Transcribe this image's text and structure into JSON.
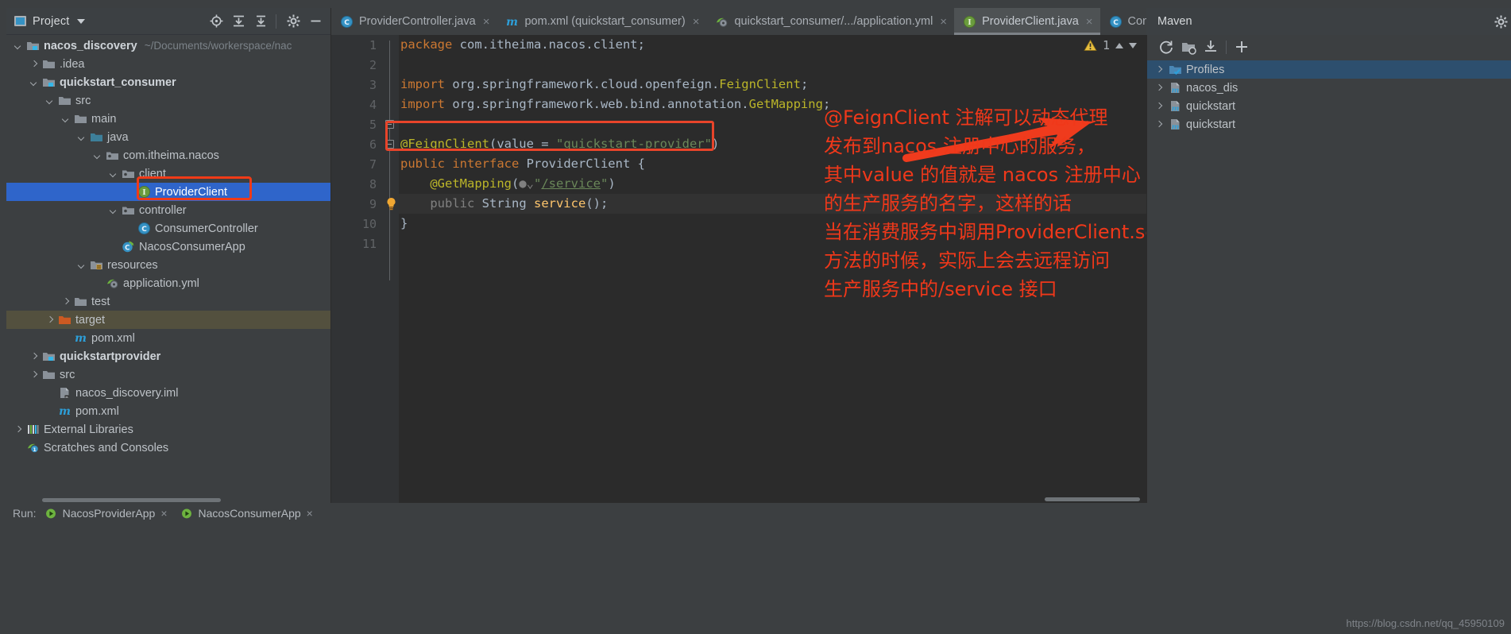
{
  "window": {
    "project_tool_title": "Project",
    "maven_tool_title": "Maven"
  },
  "project_panel": {
    "header_icons": [
      "locate-icon",
      "collapse-all-icon",
      "expand-collapse-icon",
      "settings-gear-icon",
      "hide-minus-icon"
    ],
    "tree": [
      {
        "indent": 0,
        "arrow": "down",
        "icon": "module-folder-icon",
        "label": "nacos_discovery",
        "bold": true,
        "sub": "~/Documents/workerspace/nac"
      },
      {
        "indent": 1,
        "arrow": "right",
        "icon": "folder-icon",
        "label": ".idea",
        "bold": false,
        "sub": ""
      },
      {
        "indent": 1,
        "arrow": "down",
        "icon": "module-folder-icon",
        "label": "quickstart_consumer",
        "bold": true,
        "sub": ""
      },
      {
        "indent": 2,
        "arrow": "down",
        "icon": "folder-icon",
        "label": "src",
        "bold": false,
        "sub": ""
      },
      {
        "indent": 3,
        "arrow": "down",
        "icon": "folder-icon",
        "label": "main",
        "bold": false,
        "sub": ""
      },
      {
        "indent": 4,
        "arrow": "down",
        "icon": "source-folder-icon",
        "label": "java",
        "bold": false,
        "sub": ""
      },
      {
        "indent": 5,
        "arrow": "down",
        "icon": "package-icon",
        "label": "com.itheima.nacos",
        "bold": false,
        "sub": ""
      },
      {
        "indent": 6,
        "arrow": "down",
        "icon": "package-icon",
        "label": "client",
        "bold": false,
        "sub": ""
      },
      {
        "indent": 7,
        "arrow": "none",
        "icon": "interface-icon",
        "label": "ProviderClient",
        "bold": false,
        "sub": "",
        "selected": true
      },
      {
        "indent": 6,
        "arrow": "down",
        "icon": "package-icon",
        "label": "controller",
        "bold": false,
        "sub": ""
      },
      {
        "indent": 7,
        "arrow": "none",
        "icon": "class-icon",
        "label": "ConsumerController",
        "bold": false,
        "sub": ""
      },
      {
        "indent": 6,
        "arrow": "none",
        "icon": "spring-class-icon",
        "label": "NacosConsumerApp",
        "bold": false,
        "sub": ""
      },
      {
        "indent": 4,
        "arrow": "down",
        "icon": "resources-folder-icon",
        "label": "resources",
        "bold": false,
        "sub": ""
      },
      {
        "indent": 5,
        "arrow": "none",
        "icon": "yaml-spring-icon",
        "label": "application.yml",
        "bold": false,
        "sub": ""
      },
      {
        "indent": 3,
        "arrow": "right",
        "icon": "folder-icon",
        "label": "test",
        "bold": false,
        "sub": ""
      },
      {
        "indent": 2,
        "arrow": "right",
        "icon": "target-folder-icon",
        "label": "target",
        "bold": false,
        "sub": "",
        "highlight": true
      },
      {
        "indent": 3,
        "arrow": "none",
        "icon": "maven-xml-icon",
        "label": "pom.xml",
        "bold": false,
        "sub": ""
      },
      {
        "indent": 1,
        "arrow": "right",
        "icon": "module-folder-icon",
        "label": "quickstartprovider",
        "bold": true,
        "sub": ""
      },
      {
        "indent": 1,
        "arrow": "right",
        "icon": "folder-icon",
        "label": "src",
        "bold": false,
        "sub": ""
      },
      {
        "indent": 2,
        "arrow": "none",
        "icon": "iml-file-icon",
        "label": "nacos_discovery.iml",
        "bold": false,
        "sub": ""
      },
      {
        "indent": 2,
        "arrow": "none",
        "icon": "maven-xml-icon",
        "label": "pom.xml",
        "bold": false,
        "sub": ""
      },
      {
        "indent": 0,
        "arrow": "right",
        "icon": "libraries-icon",
        "label": "External Libraries",
        "bold": false,
        "sub": ""
      },
      {
        "indent": 0,
        "arrow": "none",
        "icon": "scratches-icon",
        "label": "Scratches and Consoles",
        "bold": false,
        "sub": ""
      }
    ]
  },
  "editor_tabs": [
    {
      "icon": "class-icon",
      "label": "ProviderController.java",
      "active": false,
      "closable": true
    },
    {
      "icon": "maven-xml-icon",
      "label": "pom.xml (quickstart_consumer)",
      "active": false,
      "closable": true
    },
    {
      "icon": "yaml-spring-icon",
      "label": "quickstart_consumer/.../application.yml",
      "active": false,
      "closable": true
    },
    {
      "icon": "interface-icon",
      "label": "ProviderClient.java",
      "active": true,
      "closable": true
    },
    {
      "icon": "class-icon",
      "label": "Consum",
      "active": false,
      "closable": false,
      "overflow_chevron": true
    }
  ],
  "editor": {
    "warning_count": "1",
    "lines": [
      {
        "n": "1",
        "tokens": [
          {
            "t": "package ",
            "c": "kw"
          },
          {
            "t": "com.itheima.nacos.client;",
            "c": "id"
          }
        ]
      },
      {
        "n": "2",
        "tokens": []
      },
      {
        "n": "3",
        "tokens": [
          {
            "t": "import ",
            "c": "kw"
          },
          {
            "t": "org.springframework.cloud.openfeign.",
            "c": "id"
          },
          {
            "t": "FeignClient",
            "c": "ann"
          },
          {
            "t": ";",
            "c": "id"
          }
        ]
      },
      {
        "n": "4",
        "tokens": [
          {
            "t": "import ",
            "c": "kw"
          },
          {
            "t": "org.springframework.web.bind.annotation.",
            "c": "id"
          },
          {
            "t": "GetMapping",
            "c": "ann"
          },
          {
            "t": ";",
            "c": "id"
          }
        ]
      },
      {
        "n": "5",
        "tokens": []
      },
      {
        "n": "6",
        "tokens": [
          {
            "t": "@FeignClient",
            "c": "ann"
          },
          {
            "t": "(value = ",
            "c": "id"
          },
          {
            "t": "\"quickstart-provider\"",
            "c": "str"
          },
          {
            "t": ")",
            "c": "id"
          }
        ]
      },
      {
        "n": "7",
        "tokens": [
          {
            "t": "public ",
            "c": "kw"
          },
          {
            "t": "interface ",
            "c": "kw"
          },
          {
            "t": "ProviderClient ",
            "c": "id"
          },
          {
            "t": "{",
            "c": "id"
          }
        ]
      },
      {
        "n": "8",
        "tokens": [
          {
            "t": "    @GetMapping",
            "c": "ann"
          },
          {
            "t": "(",
            "c": "id"
          },
          {
            "t": "●⌄",
            "c": "gray"
          },
          {
            "t": "\"",
            "c": "str"
          },
          {
            "t": "/service",
            "c": "link"
          },
          {
            "t": "\"",
            "c": "str"
          },
          {
            "t": ")",
            "c": "id"
          }
        ]
      },
      {
        "n": "9",
        "tokens": [
          {
            "t": "    public ",
            "c": "gray"
          },
          {
            "t": "String ",
            "c": "id"
          },
          {
            "t": "service",
            "c": "mth"
          },
          {
            "t": "();",
            "c": "id"
          }
        ]
      },
      {
        "n": "10",
        "tokens": [
          {
            "t": "}",
            "c": "id"
          }
        ]
      },
      {
        "n": "11",
        "tokens": []
      }
    ]
  },
  "annotation": {
    "lines": [
      "@FeignClient 注解可以动态代理",
      "发布到nacos 注册中心的服务，",
      "其中value 的值就是 nacos 注册中心",
      "的生产服务的名字，这样的话",
      "当在消费服务中调用ProviderClient.serice",
      "方法的时候，实际上会去远程访问",
      "生产服务中的/service 接口"
    ],
    "color": "#f0381a"
  },
  "maven_panel": {
    "toolbar_icons": [
      "reload-icon",
      "add-folder-icon",
      "download-sources-icon",
      "add-icon",
      "settings-gear-icon"
    ],
    "tree": [
      {
        "arrow": "right",
        "icon": "profiles-icon",
        "label": "Profiles",
        "selected": true
      },
      {
        "arrow": "right",
        "icon": "maven-module-icon",
        "label": "nacos_dis",
        "selected": false
      },
      {
        "arrow": "right",
        "icon": "maven-module-icon",
        "label": "quickstart",
        "selected": false
      },
      {
        "arrow": "right",
        "icon": "maven-module-icon",
        "label": "quickstart",
        "selected": false
      }
    ]
  },
  "run_bar": {
    "label": "Run:",
    "items": [
      {
        "icon": "spring-run-icon",
        "label": "NacosProviderApp"
      },
      {
        "icon": "spring-run-icon",
        "label": "NacosConsumerApp"
      }
    ],
    "close_glyph": "×"
  },
  "watermark": {
    "text": "https://blog.csdn.net/qq_45950109"
  },
  "colors": {
    "selection_blue": "#2f65ca",
    "annotation_red": "#f0381a",
    "editor_bg": "#2b2b2b",
    "panel_bg": "#3c3f41",
    "target_highlight": "#53503e"
  }
}
